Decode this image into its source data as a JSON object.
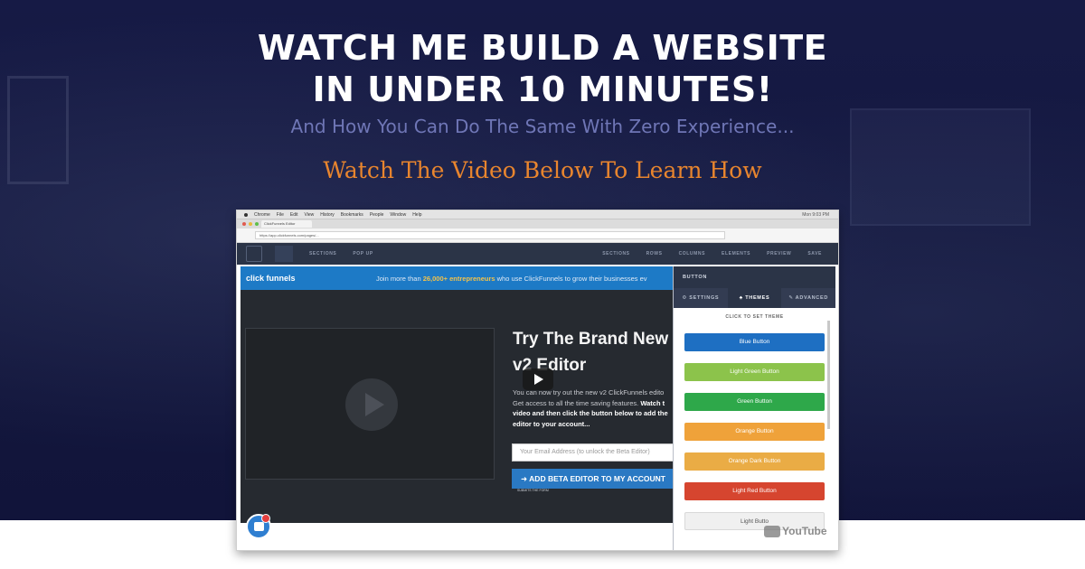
{
  "hero": {
    "headline_line1": "WATCH ME BUILD A WEBSITE",
    "headline_line2": "IN UNDER 10 MINUTES!",
    "subheadline": "And How You Can Do The Same With Zero Experience...",
    "cta_heading": "Watch The Video Below To Learn How"
  },
  "colors": {
    "hero_background": "#14183f",
    "subheadline": "#6f76b6",
    "cta_heading": "#e8852e",
    "editor_blue": "#1d7ac6"
  },
  "video": {
    "mac_menu": [
      "Chrome",
      "File",
      "Edit",
      "View",
      "History",
      "Bookmarks",
      "People",
      "Window",
      "Help"
    ],
    "mac_right": "Mon 9:03 PM",
    "browser_tab": "ClickFunnels Editor",
    "url": "https://app.clickfunnels.com/pages/...",
    "toolbar": {
      "left_items": [
        "SECTIONS",
        "POP UP"
      ],
      "right_items": [
        "SECTIONS",
        "ROWS",
        "COLUMNS",
        "ELEMENTS",
        "PREVIEW",
        "SAVE"
      ]
    },
    "banner": {
      "brand": "click funnels",
      "text_prefix": "Join more than ",
      "text_highlight": "26,000+ entrepreneurs",
      "text_suffix": " who use ClickFunnels to grow their businesses ev"
    },
    "promo": {
      "title": "Try The Brand New v2 Editor",
      "body_prefix": "You can now try out the new v2 ClickFunnels edito Get access to all the time saving features. ",
      "body_bold": "Watch t video and then click the button below to add the editor to your account...",
      "email_placeholder": "Your Email Address (to unlock the Beta Editor)",
      "button_label": "➜ ADD BETA EDITOR TO MY ACCOUNT",
      "button_sub": "SUBMITS THE FORM"
    },
    "panel": {
      "header": "BUTTON",
      "tabs": [
        "⚙ SETTINGS",
        "♣ THEMES",
        "✎ ADVANCED"
      ],
      "active_tab": "♣ THEMES",
      "subheader": "CLICK TO SET THEME",
      "themes": [
        {
          "label": "Blue Button",
          "color": "#1e6fc2"
        },
        {
          "label": "Light Green Button",
          "color": "#8cc34b"
        },
        {
          "label": "Green Button",
          "color": "#2ea84a"
        },
        {
          "label": "Orange Button",
          "color": "#efa23a"
        },
        {
          "label": "Orange Dark Button",
          "color": "#eaac45"
        },
        {
          "label": "Light Red Button",
          "color": "#d6452f"
        },
        {
          "label": "Light Butto",
          "color": "#f0f0f0"
        }
      ]
    },
    "youtube_logo": "YouTube"
  }
}
